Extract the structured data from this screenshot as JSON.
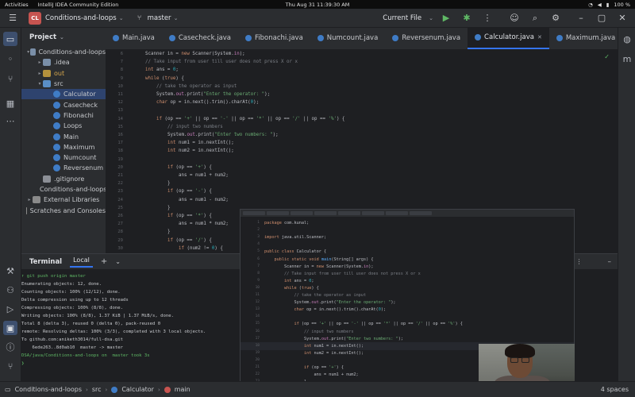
{
  "os_bar": {
    "activities": "Activities",
    "app_name": "IntelliJ IDEA Community Edition",
    "datetime": "Thu Aug 31  11:39:30 AM",
    "battery": "100 %"
  },
  "toolbar": {
    "project_badge": "CL",
    "project_name": "Conditions-and-loops",
    "branch": "master",
    "run_config": "Current File"
  },
  "project_panel": {
    "title": "Project",
    "tree": [
      {
        "label": "Conditions-and-loops",
        "type": "folder",
        "indent": 0,
        "arrow": "▾"
      },
      {
        "label": ".idea",
        "type": "folder",
        "indent": 1,
        "arrow": "▸"
      },
      {
        "label": "out",
        "type": "folder-out",
        "indent": 1,
        "arrow": "▸"
      },
      {
        "label": "src",
        "type": "folder-src",
        "indent": 1,
        "arrow": "▾"
      },
      {
        "label": "Calculator",
        "type": "cls",
        "indent": 2,
        "arrow": "",
        "selected": true
      },
      {
        "label": "Casecheck",
        "type": "cls",
        "indent": 2,
        "arrow": ""
      },
      {
        "label": "Fibonachi",
        "type": "cls",
        "indent": 2,
        "arrow": ""
      },
      {
        "label": "Loops",
        "type": "cls",
        "indent": 2,
        "arrow": ""
      },
      {
        "label": "Main",
        "type": "cls",
        "indent": 2,
        "arrow": ""
      },
      {
        "label": "Maximum",
        "type": "cls",
        "indent": 2,
        "arrow": ""
      },
      {
        "label": "Numcount",
        "type": "cls",
        "indent": 2,
        "arrow": ""
      },
      {
        "label": "Reversenum",
        "type": "cls",
        "indent": 2,
        "arrow": ""
      },
      {
        "label": ".gitignore",
        "type": "file",
        "indent": 1,
        "arrow": ""
      },
      {
        "label": "Conditions-and-loops",
        "type": "file",
        "indent": 1,
        "arrow": ""
      },
      {
        "label": "External Libraries",
        "type": "lib",
        "indent": 0,
        "arrow": "▸"
      },
      {
        "label": "Scratches and Consoles",
        "type": "lib",
        "indent": 0,
        "arrow": ""
      }
    ]
  },
  "tabs": [
    {
      "label": "Main.java",
      "active": false
    },
    {
      "label": "Casecheck.java",
      "active": false
    },
    {
      "label": "Fibonachi.java",
      "active": false
    },
    {
      "label": "Numcount.java",
      "active": false
    },
    {
      "label": "Reversenum.java",
      "active": false
    },
    {
      "label": "Calculator.java",
      "active": true
    },
    {
      "label": "Maximum.java",
      "active": false
    }
  ],
  "editor": {
    "lines": [
      {
        "n": "6",
        "indent": 2,
        "html": "Scanner in = <k>new</k> Scanner(System.<f>in</f>);"
      },
      {
        "n": "7",
        "indent": 2,
        "html": "<c>// Take input from user till user does not press X or x</c>"
      },
      {
        "n": "8",
        "indent": 2,
        "html": "<k>int</k> ans = <n>0</n>;"
      },
      {
        "n": "9",
        "indent": 2,
        "html": "<k>while</k> (<k>true</k>) {"
      },
      {
        "n": "10",
        "indent": 3,
        "html": "<c>// take the operator as input</c>"
      },
      {
        "n": "11",
        "indent": 3,
        "html": "System.<f>out</f>.print(<s>\"Enter the operator: \"</s>);"
      },
      {
        "n": "12",
        "indent": 3,
        "html": "<k>char</k> op = in.next().trim().charAt(<n>0</n>);"
      },
      {
        "n": "13",
        "indent": 0,
        "html": ""
      },
      {
        "n": "14",
        "indent": 3,
        "html": "<k>if</k> (op == <s>'+'</s> || op == <s>'-'</s> || op == <s>'*'</s> || op == <s>'/'</s> || op == <s>'%'</s>) {"
      },
      {
        "n": "15",
        "indent": 4,
        "html": "<c>// input two numbers</c>"
      },
      {
        "n": "16",
        "indent": 4,
        "html": "System.<f>out</f>.print(<s>\"Enter two numbers: \"</s>);"
      },
      {
        "n": "17",
        "indent": 4,
        "html": "<k>int</k> num1 = in.nextInt();"
      },
      {
        "n": "18",
        "indent": 4,
        "html": "<k>int</k> num2 = in.nextInt();"
      },
      {
        "n": "19",
        "indent": 0,
        "html": ""
      },
      {
        "n": "20",
        "indent": 4,
        "html": "<k>if</k> (op == <s>'+'</s>) {"
      },
      {
        "n": "21",
        "indent": 5,
        "html": "ans = num1 + num2;"
      },
      {
        "n": "22",
        "indent": 4,
        "html": "}"
      },
      {
        "n": "23",
        "indent": 4,
        "html": "<k>if</k> (op == <s>'-'</s>) {"
      },
      {
        "n": "24",
        "indent": 5,
        "html": "ans = num1 - num2;"
      },
      {
        "n": "25",
        "indent": 4,
        "html": "}"
      },
      {
        "n": "26",
        "indent": 4,
        "html": "<k>if</k> (op == <s>'*'</s>) {"
      },
      {
        "n": "27",
        "indent": 5,
        "html": "ans = num1 * num2;"
      },
      {
        "n": "28",
        "indent": 4,
        "html": "}"
      },
      {
        "n": "29",
        "indent": 4,
        "html": "<k>if</k> (op == <s>'/'</s>) {"
      },
      {
        "n": "30",
        "indent": 5,
        "html": "<k>if</k> (num2 != <n>0</n>) {"
      }
    ]
  },
  "terminal": {
    "title": "Terminal",
    "tab_name": "Local",
    "lines": [
      "↑ git push origin master",
      "Enumerating objects: 12, done.",
      "Counting objects: 100% (12/12), done.",
      "Delta compression using up to 12 threads",
      "Compressing objects: 100% (8/8), done.",
      "Writing objects: 100% (8/8), 1.37 KiB | 1.37 MiB/s, done.",
      "Total 8 (delta 3), reused 0 (delta 0), pack-reused 0",
      "remote: Resolving deltas: 100% (3/3), completed with 3 local objects.",
      "To github.com:aniketh3014/full-dsa.git",
      "    6ede263..8d0ab10  master -> master",
      "",
      "DSA/java/Conditions-and-loops on  master took 3s",
      "❯"
    ]
  },
  "overlay": {
    "lines": [
      {
        "n": "1",
        "html": "<k>package</k> com.kunal;"
      },
      {
        "n": "2",
        "html": ""
      },
      {
        "n": "3",
        "html": "<k>import</k> java.util.Scanner;"
      },
      {
        "n": "4",
        "html": ""
      },
      {
        "n": "5",
        "html": "<k>public class</k> Calculator {"
      },
      {
        "n": "6",
        "html": "    <k>public static void</k> <m>main</m>(String[] args) {"
      },
      {
        "n": "7",
        "html": "        Scanner in = <k>new</k> Scanner(System.<f>in</f>);"
      },
      {
        "n": "8",
        "html": "        <c>// Take input from user till user does not press X or x</c>"
      },
      {
        "n": "9",
        "html": "        <k>int</k> ans = <n>0</n>;"
      },
      {
        "n": "10",
        "html": "        <k>while</k> (<k>true</k>) {"
      },
      {
        "n": "11",
        "html": "            <c>// take the operator as input</c>"
      },
      {
        "n": "12",
        "html": "            System.<f>out</f>.print(<s>\"Enter the operator: \"</s>);"
      },
      {
        "n": "13",
        "html": "            <k>char</k> op = in.next().trim().charAt(<n>0</n>);"
      },
      {
        "n": "14",
        "html": ""
      },
      {
        "n": "15",
        "html": "            <k>if</k> (op == <s>'+'</s> || op == <s>'-'</s> || op == <s>'*'</s> || op == <s>'/'</s> || op == <s>'%'</s>) {"
      },
      {
        "n": "16",
        "html": "                <c>// input two numbers</c>"
      },
      {
        "n": "17",
        "html": "                System.<f>out</f>.print(<s>\"Enter two numbers: \"</s>);"
      },
      {
        "n": "18",
        "html": "                <k>int</k> num1 = in.nextInt();"
      },
      {
        "n": "19",
        "html": "                <k>int</k> num2 = in.nextInt();"
      },
      {
        "n": "20",
        "html": ""
      },
      {
        "n": "21",
        "html": "                <k>if</k> (op == <s>'+'</s>) {"
      },
      {
        "n": "22",
        "html": "                    ans = num1 + num2;"
      },
      {
        "n": "23",
        "html": "                }"
      }
    ]
  },
  "statusbar": {
    "crumbs": [
      "Conditions-and-loops",
      "src",
      "Calculator",
      "main"
    ],
    "indent": "4 spaces"
  },
  "colors": {
    "accent": "#3574f0",
    "run_green": "#5fb865",
    "project_badge": "#c75450"
  }
}
